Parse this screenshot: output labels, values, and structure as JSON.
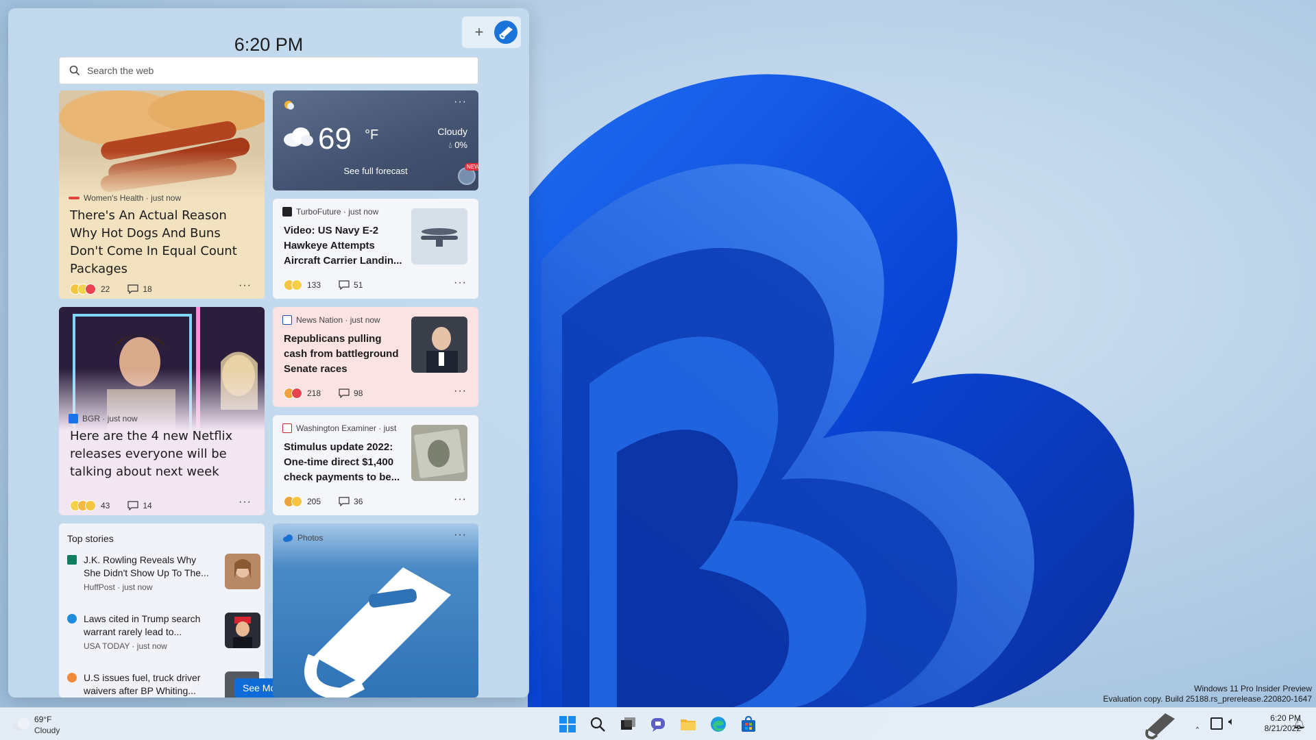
{
  "panel": {
    "time": "6:20 PM",
    "add_label": "+",
    "search": {
      "placeholder": "Search the web"
    }
  },
  "cards": {
    "hotdog": {
      "source": "Women's Health · just now",
      "headline": "There's An Actual Reason Why Hot Dogs And Buns Don't Come In Equal Count Packages",
      "reactions": "22",
      "comments": "18"
    },
    "weather": {
      "temperature": "69",
      "unit": "°F",
      "condition": "Cloudy",
      "precip": "0%",
      "forecast_link": "See full forecast",
      "badge": "NEW"
    },
    "navy": {
      "source": "TurboFuture · just now",
      "headline": "Video: US Navy E-2 Hawkeye Attempts Aircraft Carrier Landin...",
      "reactions": "133",
      "comments": "51"
    },
    "netflix": {
      "source": "BGR · just now",
      "headline": "Here are the 4 new Netflix releases everyone will be talking about next week",
      "reactions": "43",
      "comments": "14"
    },
    "republicans": {
      "source": "News Nation · just now",
      "headline": "Republicans pulling cash from battleground Senate races",
      "reactions": "218",
      "comments": "98"
    },
    "stimulus": {
      "source": "Washington Examiner · just",
      "headline": "Stimulus update 2022: One-time direct $1,400 check payments to be...",
      "reactions": "205",
      "comments": "36"
    },
    "top_stories": {
      "title": "Top stories",
      "items": [
        {
          "headline": "J.K. Rowling Reveals Why She Didn't Show Up To The...",
          "meta": "HuffPost · just now"
        },
        {
          "headline": "Laws cited in Trump search warrant rarely lead to...",
          "meta": "USA TODAY · just now"
        },
        {
          "headline": "U.S issues fuel, truck driver waivers after BP Whiting..."
        }
      ]
    },
    "photos": {
      "title": "Photos"
    }
  },
  "see_more": "See More",
  "taskbar": {
    "weather_temp": "69°F",
    "weather_cond": "Cloudy",
    "time": "6:20 PM",
    "date": "8/21/2022"
  },
  "watermark": {
    "line1": "Windows 11 Pro Insider Preview",
    "line2": "Evaluation copy. Build 25188.rs_prerelease.220820-1647"
  },
  "colors": {
    "accent": "#0f6cd6",
    "hotdog_card": "#f2e2bf",
    "netflix_card": "#f2e6f3",
    "republicans_card": "#fbe3e3",
    "weather_card": "#4a5a78",
    "photos_card": "#2f73b6"
  }
}
